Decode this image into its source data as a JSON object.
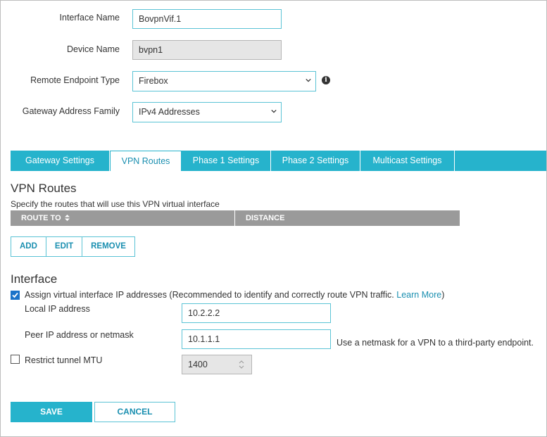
{
  "form": {
    "interface_name": {
      "label": "Interface Name",
      "value": "BovpnVif.1"
    },
    "device_name": {
      "label": "Device Name",
      "value": "bvpn1"
    },
    "remote_endpoint_type": {
      "label": "Remote Endpoint Type",
      "value": "Firebox"
    },
    "gateway_address_family": {
      "label": "Gateway Address Family",
      "value": "IPv4 Addresses"
    }
  },
  "tabs": [
    {
      "label": "Gateway Settings"
    },
    {
      "label": "VPN Routes"
    },
    {
      "label": "Phase 1 Settings"
    },
    {
      "label": "Phase 2 Settings"
    },
    {
      "label": "Multicast Settings"
    }
  ],
  "vpn_routes": {
    "title": "VPN Routes",
    "description": "Specify the routes that will use this VPN virtual interface",
    "columns": [
      "ROUTE TO",
      "DISTANCE"
    ],
    "rows": [],
    "buttons": {
      "add": "ADD",
      "edit": "EDIT",
      "remove": "REMOVE"
    }
  },
  "interface": {
    "title": "Interface",
    "assign_checkbox": {
      "checked": true,
      "label": "Assign virtual interface IP addresses (Recommended to identify and correctly route VPN traffic.",
      "link": "Learn More",
      "suffix": ")"
    },
    "local_ip": {
      "label": "Local IP address",
      "value": "10.2.2.2"
    },
    "peer_ip": {
      "label": "Peer IP address or netmask",
      "value": "10.1.1.1",
      "hint": "Use a netmask for a VPN to a third-party endpoint."
    },
    "restrict_mtu": {
      "checked": false,
      "label": "Restrict tunnel MTU",
      "value": "1400"
    }
  },
  "footer": {
    "save": "SAVE",
    "cancel": "CANCEL"
  },
  "colors": {
    "accent": "#26b3cc",
    "link": "#1a8fb0",
    "table_header": "#9a9a9a",
    "checkbox": "#1a73c9"
  }
}
